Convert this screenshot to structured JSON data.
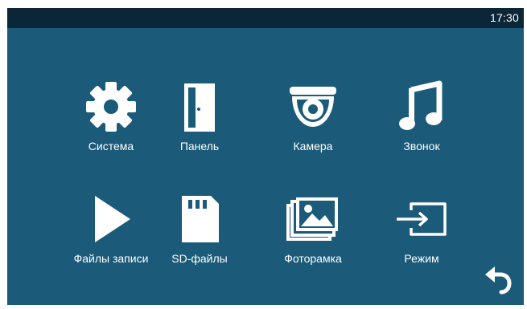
{
  "status_bar": {
    "time": "17:30"
  },
  "menu": {
    "items": [
      {
        "label": "Система",
        "icon": "gear-icon"
      },
      {
        "label": "Панель",
        "icon": "door-icon"
      },
      {
        "label": "Камера",
        "icon": "dome-camera-icon"
      },
      {
        "label": "Звонок",
        "icon": "music-note-icon"
      },
      {
        "label": "Файлы записи",
        "icon": "play-icon"
      },
      {
        "label": "SD-файлы",
        "icon": "sd-card-icon"
      },
      {
        "label": "Фоторамка",
        "icon": "photo-frame-icon"
      },
      {
        "label": "Режим",
        "icon": "input-mode-icon"
      }
    ]
  },
  "back_button": {
    "icon": "back-arrow-icon"
  },
  "colors": {
    "background": "#1b5a78",
    "topbar": "#0a2637",
    "foreground": "#ffffff"
  }
}
